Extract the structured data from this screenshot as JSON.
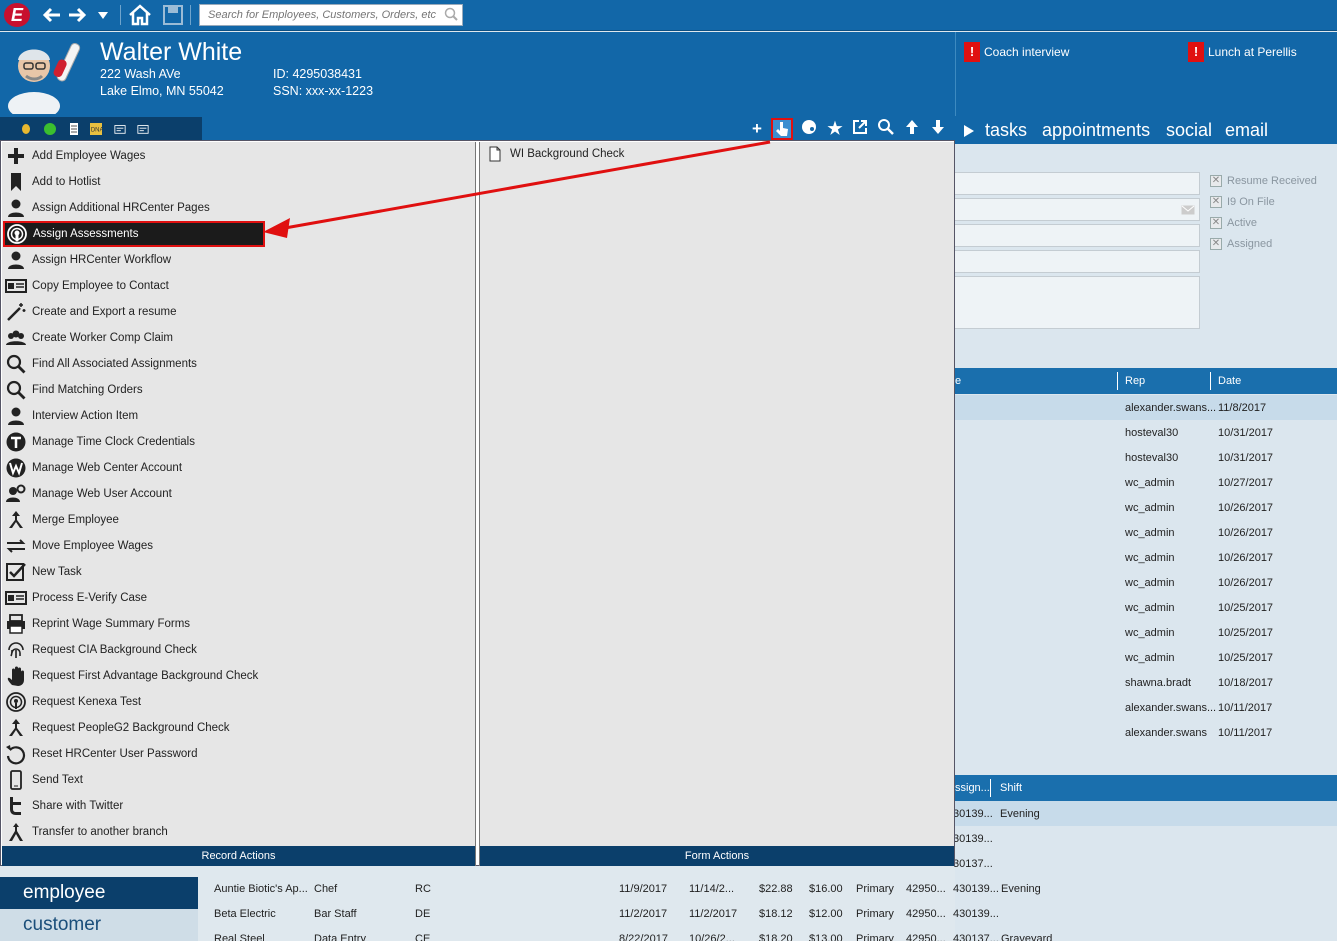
{
  "toolbar": {
    "logo_letter": "E",
    "search_placeholder": "Search for Employees, Customers, Orders, etc."
  },
  "employee": {
    "name": "Walter White",
    "address1": "222 Wash AVe",
    "address2": "Lake Elmo, MN 55042",
    "id": "ID: 4295038431",
    "ssn": "SSN: xxx-xx-1223"
  },
  "alerts": [
    {
      "label": "Coach interview"
    },
    {
      "label": "Lunch at Perellis"
    }
  ],
  "tabs": [
    "tasks",
    "appointments",
    "social",
    "email"
  ],
  "checkboxes": [
    "Resume Received",
    "I9 On File",
    "Active",
    "Assigned"
  ],
  "record_actions": {
    "footer": "Record Actions",
    "items": [
      {
        "label": "Add Employee Wages",
        "icon": "plus-icon"
      },
      {
        "label": "Add to Hotlist",
        "icon": "bookmark-icon"
      },
      {
        "label": "Assign Additional HRCenter Pages",
        "icon": "person-icon"
      },
      {
        "label": "Assign Assessments",
        "icon": "podcast-icon"
      },
      {
        "label": "Assign HRCenter Workflow",
        "icon": "person-icon"
      },
      {
        "label": "Copy Employee to Contact",
        "icon": "id-card-icon"
      },
      {
        "label": "Create and Export a resume",
        "icon": "magic-wand-icon"
      },
      {
        "label": "Create Worker Comp Claim",
        "icon": "group-icon"
      },
      {
        "label": "Find All Associated Assignments",
        "icon": "magnifier-icon"
      },
      {
        "label": "Find Matching Orders",
        "icon": "magnifier-icon"
      },
      {
        "label": "Interview Action Item",
        "icon": "person-icon"
      },
      {
        "label": "Manage Time Clock Credentials",
        "icon": "t-circle-icon"
      },
      {
        "label": "Manage Web Center Account",
        "icon": "w-circle-icon"
      },
      {
        "label": "Manage Web User Account",
        "icon": "user-gear-icon"
      },
      {
        "label": "Merge Employee",
        "icon": "merge-icon"
      },
      {
        "label": "Move Employee Wages",
        "icon": "transfer-icon"
      },
      {
        "label": "New Task",
        "icon": "checkbox-icon"
      },
      {
        "label": "Process E-Verify Case",
        "icon": "id-card-icon"
      },
      {
        "label": "Reprint Wage Summary Forms",
        "icon": "printer-icon"
      },
      {
        "label": "Request CIA Background Check",
        "icon": "fingerprint-icon"
      },
      {
        "label": "Request First Advantage Background Check",
        "icon": "hand-icon"
      },
      {
        "label": "Request Kenexa Test",
        "icon": "podcast-icon"
      },
      {
        "label": "Request PeopleG2 Background Check",
        "icon": "merge-icon"
      },
      {
        "label": "Reset HRCenter User Password",
        "icon": "reset-icon"
      },
      {
        "label": "Send Text",
        "icon": "phone-icon"
      },
      {
        "label": "Share with Twitter",
        "icon": "twitter-icon"
      },
      {
        "label": "Transfer to another branch",
        "icon": "branch-icon"
      }
    ]
  },
  "form_actions": {
    "footer": "Form Actions",
    "items": [
      {
        "label": "WI Background Check",
        "icon": "document-icon"
      }
    ]
  },
  "activity_grid": {
    "columns": [
      "e",
      "Rep",
      "Date"
    ],
    "rows": [
      [
        "alexander.swans...",
        "11/8/2017"
      ],
      [
        "hosteval30",
        "10/31/2017"
      ],
      [
        "hosteval30",
        "10/31/2017"
      ],
      [
        "wc_admin",
        "10/27/2017"
      ],
      [
        "wc_admin",
        "10/26/2017"
      ],
      [
        "wc_admin",
        "10/26/2017"
      ],
      [
        "wc_admin",
        "10/26/2017"
      ],
      [
        "wc_admin",
        "10/26/2017"
      ],
      [
        "wc_admin",
        "10/25/2017"
      ],
      [
        "wc_admin",
        "10/25/2017"
      ],
      [
        "wc_admin",
        "10/25/2017"
      ],
      [
        "shawna.bradt",
        "10/18/2017"
      ],
      [
        "alexander.swans...",
        "10/11/2017"
      ],
      [
        "alexander.swans",
        "10/11/2017"
      ]
    ]
  },
  "assign_grid": {
    "columns": [
      "ssign...",
      "Shift"
    ],
    "rows_right": [
      [
        "30139...",
        "Evening"
      ],
      [
        "30139...",
        ""
      ],
      [
        "30137...",
        ""
      ]
    ],
    "rows_full": [
      [
        "Auntie Biotic's Ap...",
        "Chef",
        "RC",
        "11/9/2017",
        "11/14/2...",
        "$22.88",
        "$16.00",
        "Primary",
        "42950...",
        "430139...",
        "Evening"
      ],
      [
        "Beta Electric",
        "Bar Staff",
        "DE",
        "11/2/2017",
        "11/2/2017",
        "$18.12",
        "$12.00",
        "Primary",
        "42950...",
        "430139...",
        ""
      ],
      [
        "Real Steel",
        "Data Entry",
        "CE",
        "8/22/2017",
        "10/26/2...",
        "$18.20",
        "$13.00",
        "Primary",
        "42950...",
        "430137...",
        "Graveyard"
      ]
    ]
  },
  "left_nav": [
    "employee",
    "customer"
  ],
  "colors": {
    "accent": "#1267a8",
    "highlight_border": "#e01010",
    "panel_footer": "#0b3f6b"
  }
}
